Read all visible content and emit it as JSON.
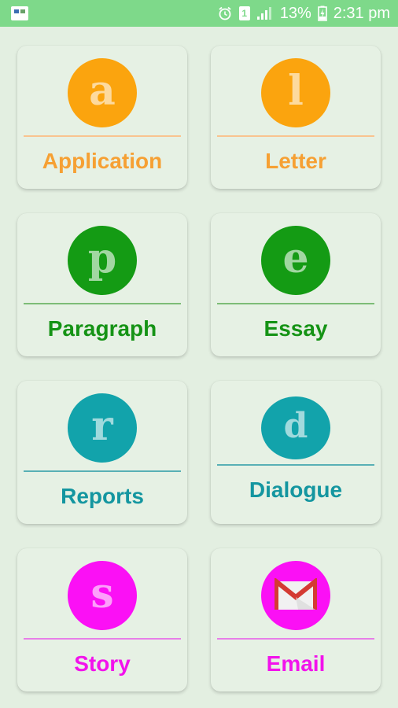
{
  "status_bar": {
    "app_icon": "app-notification-icon",
    "icons": [
      "alarm-icon",
      "sim-1-icon",
      "signal-icon",
      "battery-charging-icon"
    ],
    "sim_label": "1",
    "battery": "13%",
    "time": "2:31 pm"
  },
  "colors": {
    "status_bar": "#7ed98a",
    "background": "#e3efe1",
    "orange": "#fba40e",
    "green": "#149b14",
    "teal": "#12a3ab",
    "magenta": "#fb10f5"
  },
  "categories": [
    {
      "letter": "a",
      "label": "Application",
      "color": "orange"
    },
    {
      "letter": "l",
      "label": "Letter",
      "color": "orange"
    },
    {
      "letter": "p",
      "label": "Paragraph",
      "color": "green"
    },
    {
      "letter": "e",
      "label": "Essay",
      "color": "green"
    },
    {
      "letter": "r",
      "label": "Reports",
      "color": "teal"
    },
    {
      "letter": "d",
      "label": "Dialogue",
      "color": "teal"
    },
    {
      "letter": "s",
      "label": "Story",
      "color": "magenta"
    },
    {
      "letter": "",
      "label": "Email",
      "color": "magenta",
      "icon": "gmail-envelope-icon"
    }
  ]
}
